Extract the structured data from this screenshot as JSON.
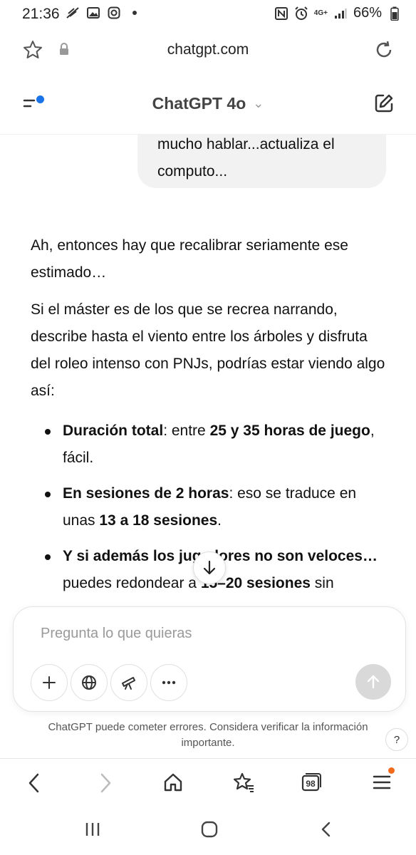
{
  "status_bar": {
    "time": "21:36",
    "battery": "66%",
    "network": "4G+"
  },
  "browser": {
    "url": "chatgpt.com",
    "tab_count": "98"
  },
  "app": {
    "title": "ChatGPT 4o",
    "accent": "#1a73e8"
  },
  "conversation": {
    "user_message_tail": "mucho hablar...actualiza el computo...",
    "assistant": {
      "p1": "Ah, entonces hay que recalibrar seriamente ese estimado…",
      "p2": "Si el máster es de los que se recrea narrando, describe hasta el viento entre los árboles y disfruta del roleo intenso con PNJs, podrías estar viendo algo así:",
      "bullets": [
        {
          "bold1": "Duración total",
          "text1": ": entre ",
          "bold2": "25 y 35 horas de juego",
          "text2": ", fácil."
        },
        {
          "bold1": "En sesiones de 2 horas",
          "text1": ": eso se traduce en unas ",
          "bold2": "13 a 18 sesiones",
          "text2": "."
        },
        {
          "bold1": "Y si además los jugadores no son veloces…",
          "text1": " puedes redondear a ",
          "bold2": "15–20 sesiones",
          "text2": " sin"
        }
      ]
    }
  },
  "composer": {
    "placeholder": "Pregunta lo que quieras"
  },
  "disclaimer": "ChatGPT puede cometer errores. Considera verificar la información importante.",
  "help_label": "?"
}
